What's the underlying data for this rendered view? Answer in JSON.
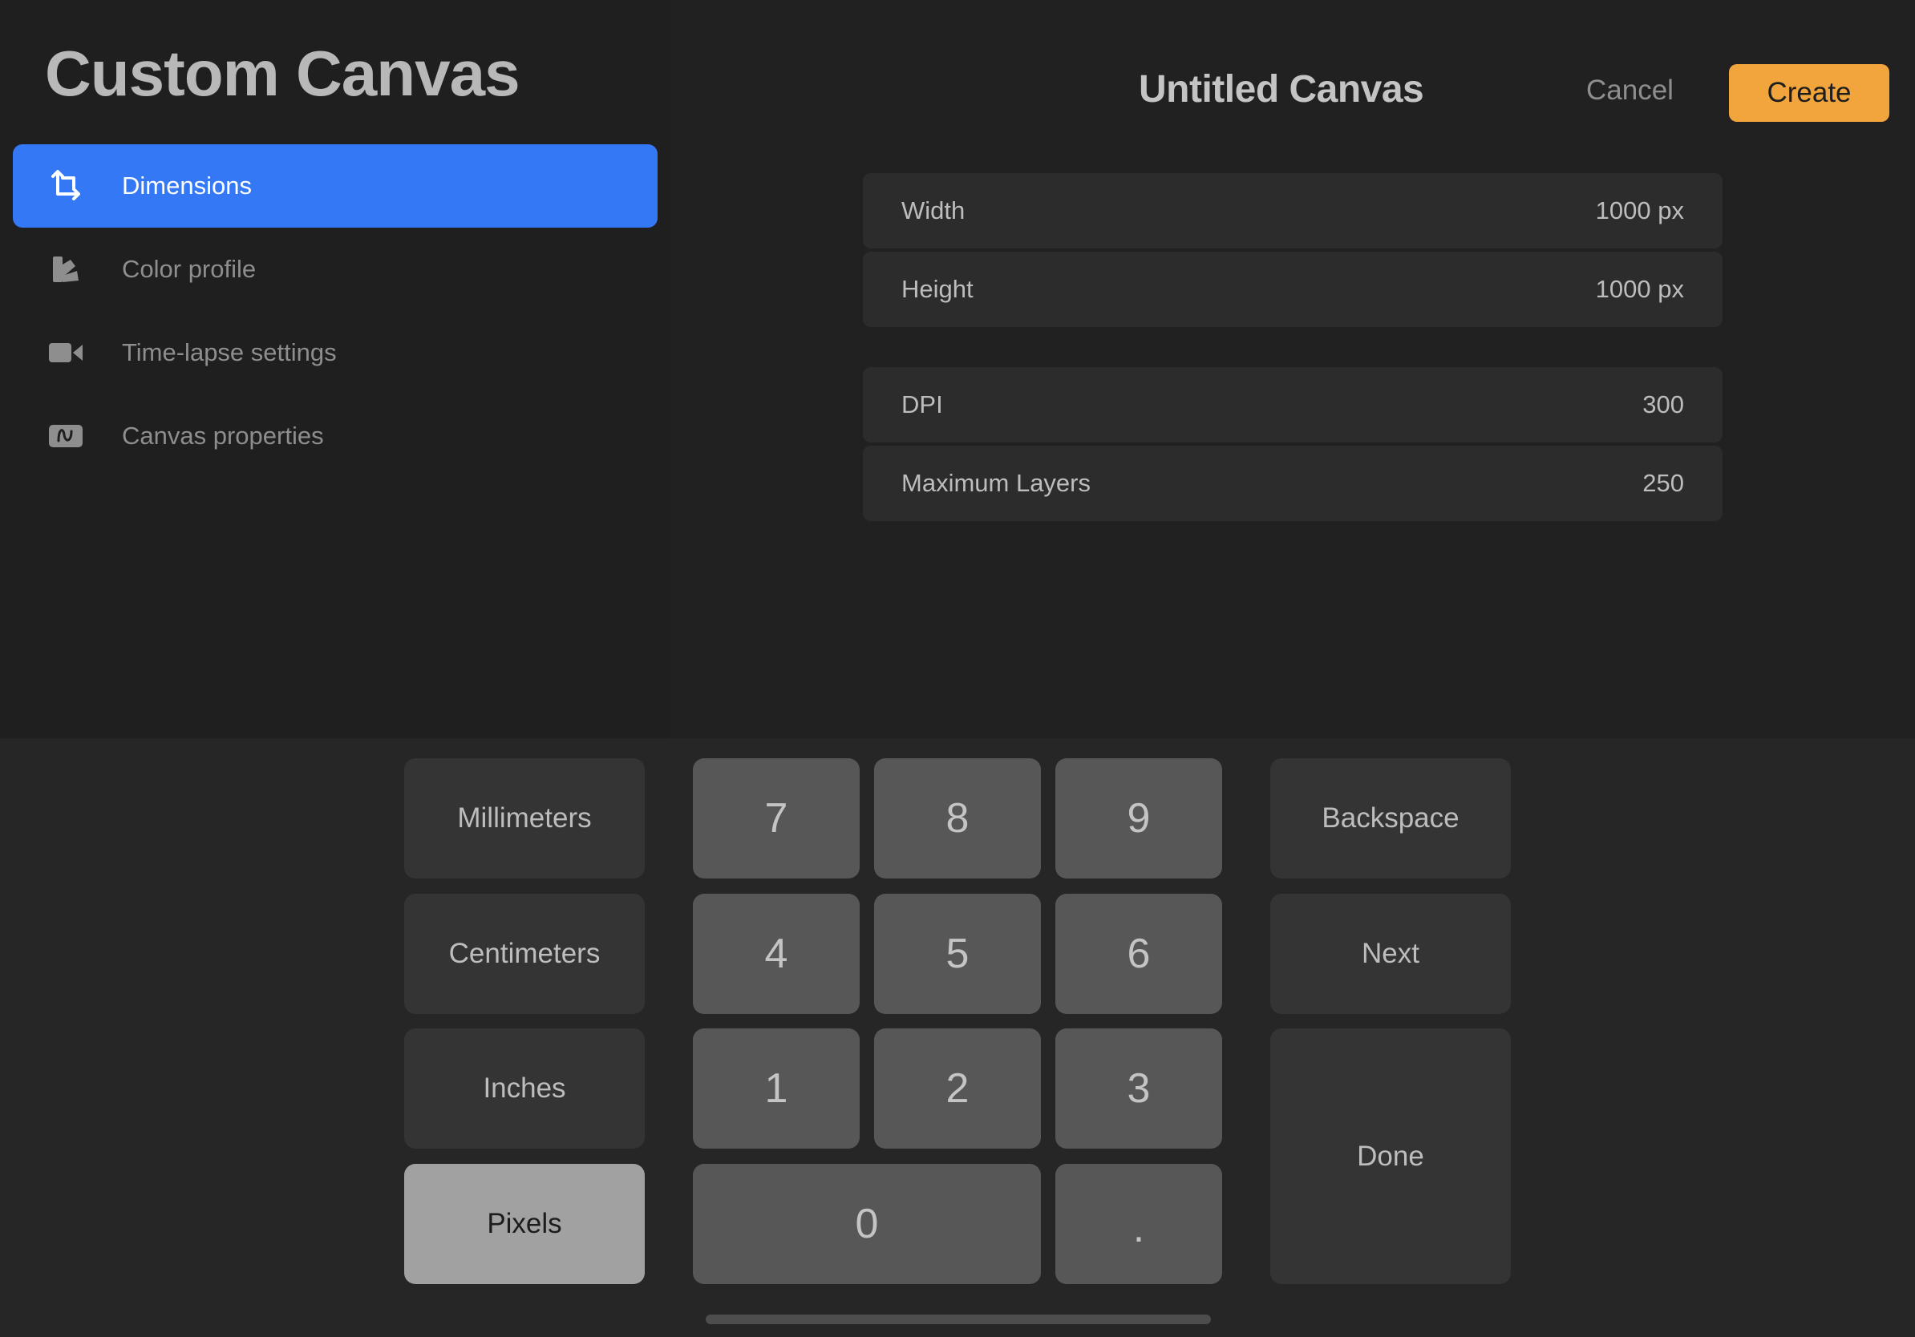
{
  "sidebar": {
    "title": "Custom Canvas",
    "items": [
      {
        "label": "Dimensions",
        "icon": "crop-icon",
        "active": true
      },
      {
        "label": "Color profile",
        "icon": "color-swatch-icon",
        "active": false
      },
      {
        "label": "Time-lapse settings",
        "icon": "video-camera-icon",
        "active": false
      },
      {
        "label": "Canvas properties",
        "icon": "waveform-icon",
        "active": false
      }
    ]
  },
  "header": {
    "canvas_title": "Untitled Canvas",
    "cancel_label": "Cancel",
    "create_label": "Create"
  },
  "fields": [
    {
      "label": "Width",
      "value": "1000 px"
    },
    {
      "label": "Height",
      "value": "1000 px"
    },
    {
      "label": "DPI",
      "value": "300"
    },
    {
      "label": "Maximum Layers",
      "value": "250"
    }
  ],
  "keypad": {
    "units": [
      "Millimeters",
      "Centimeters",
      "Inches",
      "Pixels"
    ],
    "selected_unit": "Pixels",
    "digits": [
      "7",
      "8",
      "9",
      "4",
      "5",
      "6",
      "1",
      "2",
      "3",
      "0",
      "."
    ],
    "backspace_label": "Backspace",
    "next_label": "Next",
    "done_label": "Done"
  },
  "colors": {
    "accent_blue": "#3478f6",
    "create_orange": "#f2a53c",
    "sidebar_bg": "#1f1f1f",
    "main_bg": "#212121",
    "keypad_bg": "#262626"
  }
}
